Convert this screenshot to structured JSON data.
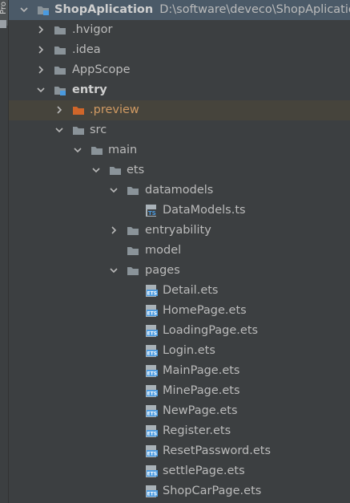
{
  "side_panel": {
    "tab_label": "Pro"
  },
  "tree": {
    "root": {
      "label": "ShopAplication",
      "path": "D:\\software\\deveco\\ShopAplication"
    },
    "hvigor": ".hvigor",
    "idea": ".idea",
    "appscope": "AppScope",
    "entry": "entry",
    "preview": ".preview",
    "src": "src",
    "main": "main",
    "ets": "ets",
    "datamodels": "datamodels",
    "datamodels_file": "DataModels.ts",
    "entryability": "entryability",
    "model": "model",
    "pages": "pages",
    "page_files": [
      "Detail.ets",
      "HomePage.ets",
      "LoadingPage.ets",
      "Login.ets",
      "MainPage.ets",
      "MinePage.ets",
      "NewPage.ets",
      "Register.ets",
      "ResetPassword.ets",
      "settlePage.ets",
      "ShopCarPage.ets"
    ]
  },
  "colors": {
    "background": "#3c3f41",
    "selection_primary": "#4b5a68",
    "selection_secondary": "#46443c",
    "folder": "#8a9399",
    "excluded_folder": "#d0662a",
    "module_badge": "#4a9ae0",
    "file_icon": "#4a9ae0"
  },
  "icons": {
    "folder": "folder-icon",
    "module_folder": "module-folder-icon",
    "excluded_folder": "excluded-folder-icon",
    "ts_file": "ts-file-icon",
    "ets_file": "ets-file-icon",
    "expand": "chevron-down-icon",
    "collapse": "chevron-right-icon"
  }
}
